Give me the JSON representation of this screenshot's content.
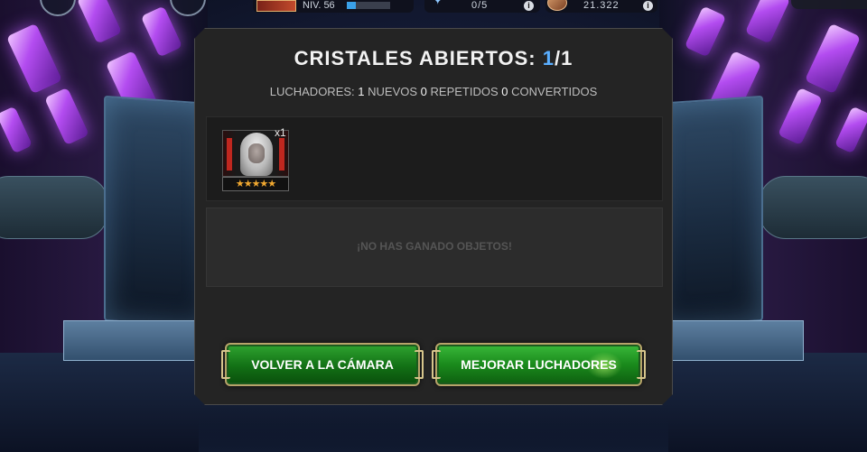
{
  "hud": {
    "level_label": "NIV. 56",
    "level_progress": 0.2,
    "energy": "0/5",
    "gold": "21.322",
    "info_glyph": "i"
  },
  "dialog": {
    "title_prefix": "CRISTALES ABIERTOS:",
    "title_count": "1",
    "title_total": "/1",
    "summary": {
      "fighters_label": "LUCHADORES:",
      "fighters_count": "1",
      "new_label": "NUEVOS",
      "new_count": "0",
      "repeated_label": "REPETIDOS",
      "repeated_count": "0",
      "converted_label": "CONVERTIDOS"
    },
    "fighter": {
      "quantity": "x1",
      "stars": "★★★★★"
    },
    "no_items_text": "¡NO HAS GANADO OBJETOS!",
    "buttons": {
      "back": "VOLVER A LA CÁMARA",
      "upgrade": "MEJORAR LUCHADORES"
    }
  },
  "colors": {
    "accent_blue": "#5aaeff",
    "button_green": "#127015",
    "star_gold": "#f0a830",
    "crystal_purple": "#b34cf0"
  },
  "icons": [
    "energy-icon",
    "gold-coin-icon",
    "info-icon",
    "star-icon"
  ]
}
